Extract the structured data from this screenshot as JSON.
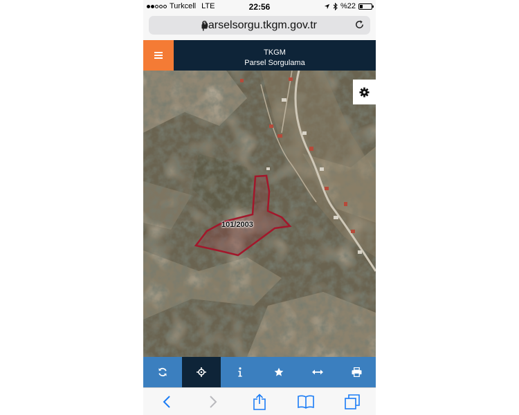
{
  "status_bar": {
    "carrier": "Turkcell",
    "network": "LTE",
    "time": "22:56",
    "battery": "%22",
    "battery_level": 0.22,
    "signal_bars": 2
  },
  "browser": {
    "url": "parselsorgu.tkgm.gov.tr",
    "icons": [
      "lock-icon",
      "reload-icon"
    ]
  },
  "header": {
    "title": "TKGM",
    "subtitle": "Parsel Sorgulama",
    "menu_icon": "hamburger-icon",
    "accent_color": "#f47b35",
    "bar_color": "#0e2438"
  },
  "map": {
    "parcel_label": "101/2003",
    "settings_icon": "gear-icon",
    "parcel_color": "#a3172b"
  },
  "toolbar": {
    "color": "#3b7fbf",
    "active_index": 1,
    "buttons": [
      "refresh-icon",
      "locate-icon",
      "info-icon",
      "star-icon",
      "measure-icon",
      "print-icon"
    ]
  },
  "safari_toolbar": {
    "icons": [
      "back-icon",
      "forward-icon",
      "share-icon",
      "bookmarks-icon",
      "tabs-icon"
    ]
  }
}
